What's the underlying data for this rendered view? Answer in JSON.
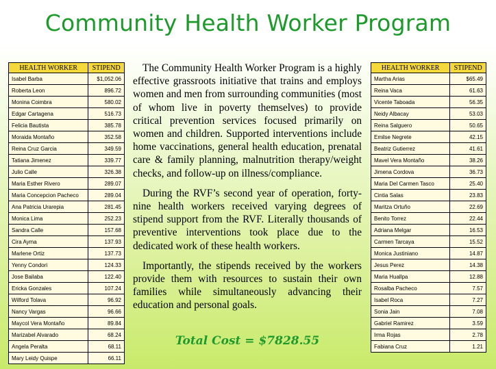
{
  "title": "Community Health Worker Program",
  "table_headers": {
    "worker": "HEALTH WORKER",
    "stipend": "STIPEND"
  },
  "left_workers": [
    {
      "name": "Isabel Barba",
      "stipend": "$1,052.06"
    },
    {
      "name": "Roberta Leon",
      "stipend": "896.72"
    },
    {
      "name": "Monina Coimbra",
      "stipend": "580.02"
    },
    {
      "name": "Edgar Cartagena",
      "stipend": "516.73"
    },
    {
      "name": "Felicia Bautista",
      "stipend": "385.78"
    },
    {
      "name": "Moraida Montaño",
      "stipend": "352.58"
    },
    {
      "name": "Reina Cruz Garcia",
      "stipend": "349.59"
    },
    {
      "name": "Tatiana Jimenez",
      "stipend": "339.77"
    },
    {
      "name": "Julio Calle",
      "stipend": "326.38"
    },
    {
      "name": "Maria Esther Rivero",
      "stipend": "289.07"
    },
    {
      "name": "Maria Concepcion Pacheco",
      "stipend": "289.04"
    },
    {
      "name": "Ana Patricia Urarepia",
      "stipend": "281.45"
    },
    {
      "name": "Monica Lima",
      "stipend": "252.23"
    },
    {
      "name": "Sandra Calle",
      "stipend": "157.68"
    },
    {
      "name": "Cira Ayma",
      "stipend": "137.93"
    },
    {
      "name": "Marlene Ortiz",
      "stipend": "137.73"
    },
    {
      "name": "Yenny Condori",
      "stipend": "124.33"
    },
    {
      "name": "Jose Bailaba",
      "stipend": "122.40"
    },
    {
      "name": "Ericka Gonzales",
      "stipend": "107.24"
    },
    {
      "name": "Wilford Tolava",
      "stipend": "96.92"
    },
    {
      "name": "Nancy Vargas",
      "stipend": "96.66"
    },
    {
      "name": "Maycol Vera Montaño",
      "stipend": "89.84"
    },
    {
      "name": "Marizabel Alvarado",
      "stipend": "68.24"
    },
    {
      "name": "Angela Peralta",
      "stipend": "68.11"
    },
    {
      "name": "Mary Leidy Quispe",
      "stipend": "66.11"
    }
  ],
  "right_workers": [
    {
      "name": "Martha Arias",
      "stipend": "$65.49"
    },
    {
      "name": "Reina Vaca",
      "stipend": "61.63"
    },
    {
      "name": "Vicente Taboada",
      "stipend": "56.35"
    },
    {
      "name": "Neidy Albacay",
      "stipend": "53.03"
    },
    {
      "name": "Reina Salguero",
      "stipend": "50.65"
    },
    {
      "name": "Emilse Negrete",
      "stipend": "42.15"
    },
    {
      "name": "Beatriz Gutierrez",
      "stipend": "41.61"
    },
    {
      "name": "Mavel Vera Montaño",
      "stipend": "38.26"
    },
    {
      "name": "Jimena Cordova",
      "stipend": "36.73"
    },
    {
      "name": "Maria Del Carmen Tasco",
      "stipend": "25.40"
    },
    {
      "name": "Cintia Salas",
      "stipend": "23.83"
    },
    {
      "name": "Maritza Ortuño",
      "stipend": "22.69"
    },
    {
      "name": "Benito Torrez",
      "stipend": "22.44"
    },
    {
      "name": "Adriana Melgar",
      "stipend": "16.53"
    },
    {
      "name": "Carmen Tarcaya",
      "stipend": "15.52"
    },
    {
      "name": "Monica Justiniano",
      "stipend": "14.87"
    },
    {
      "name": "Jesus Perez",
      "stipend": "14.38"
    },
    {
      "name": "Maria Huallpa",
      "stipend": "12.88"
    },
    {
      "name": "Rosalba Pacheco",
      "stipend": "7.57"
    },
    {
      "name": "Isabel Roca",
      "stipend": "7.27"
    },
    {
      "name": "Sonia Jain",
      "stipend": "7.08"
    },
    {
      "name": "Gabriel Ramirez",
      "stipend": "3.59"
    },
    {
      "name": "Irma Rojas",
      "stipend": "2.78"
    },
    {
      "name": "Fabiana Cruz",
      "stipend": "1.21"
    }
  ],
  "paragraphs": [
    "The Community Health Worker Program is a highly effective grassroots initiative that trains and employs women and men from surrounding communities (most of whom live in poverty themselves) to provide critical prevention services focused primarily on women and children. Supported interventions include home vaccinations, general health education, prenatal care & family planning, malnutrition therapy/weight checks, and follow-up on illness/compliance.",
    "During the RVF’s second year of operation, forty-nine health workers received varying degrees of stipend support from the RVF. Literally thousands of preventive interventions took place due to the dedicated work of these health workers.",
    "Importantly, the stipends received by the workers provide them with resources to sustain their own families while simultaneously advancing their education and personal goals."
  ],
  "total": "Total Cost = $7828.55"
}
